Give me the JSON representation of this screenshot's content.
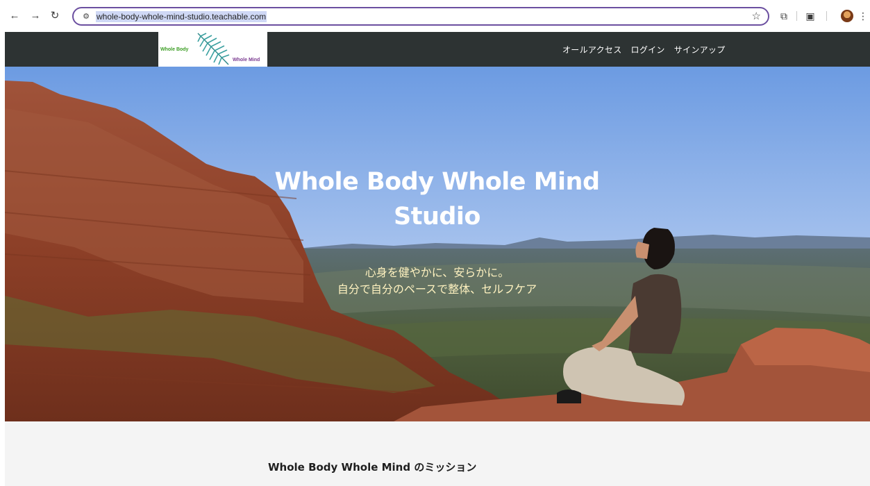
{
  "browser": {
    "back_icon": "arrow-left-icon",
    "forward_icon": "arrow-right-icon",
    "reload_icon": "reload-icon",
    "url": "whole-body-whole-mind-studio.teachable.com",
    "bookmark_icon": "star-icon"
  },
  "site": {
    "logo_text_top": "Whole Body",
    "logo_text_bottom": "Whole Mind",
    "nav": [
      "オールアクセス",
      "ログイン",
      "サインアップ"
    ]
  },
  "hero": {
    "title_line1": "Whole Body Whole Mind",
    "title_line2": "Studio",
    "subtitle_line1": "心身を健やかに、安らかに。",
    "subtitle_line2": "自分で自分のペースで整体、セルフケア"
  },
  "section": {
    "heading": "Whole Body Whole Mind のミッション"
  },
  "colors": {
    "header_bg": "#2d3333",
    "omnibox_border": "#6b4fa0",
    "subtitle": "#fff2c0"
  }
}
